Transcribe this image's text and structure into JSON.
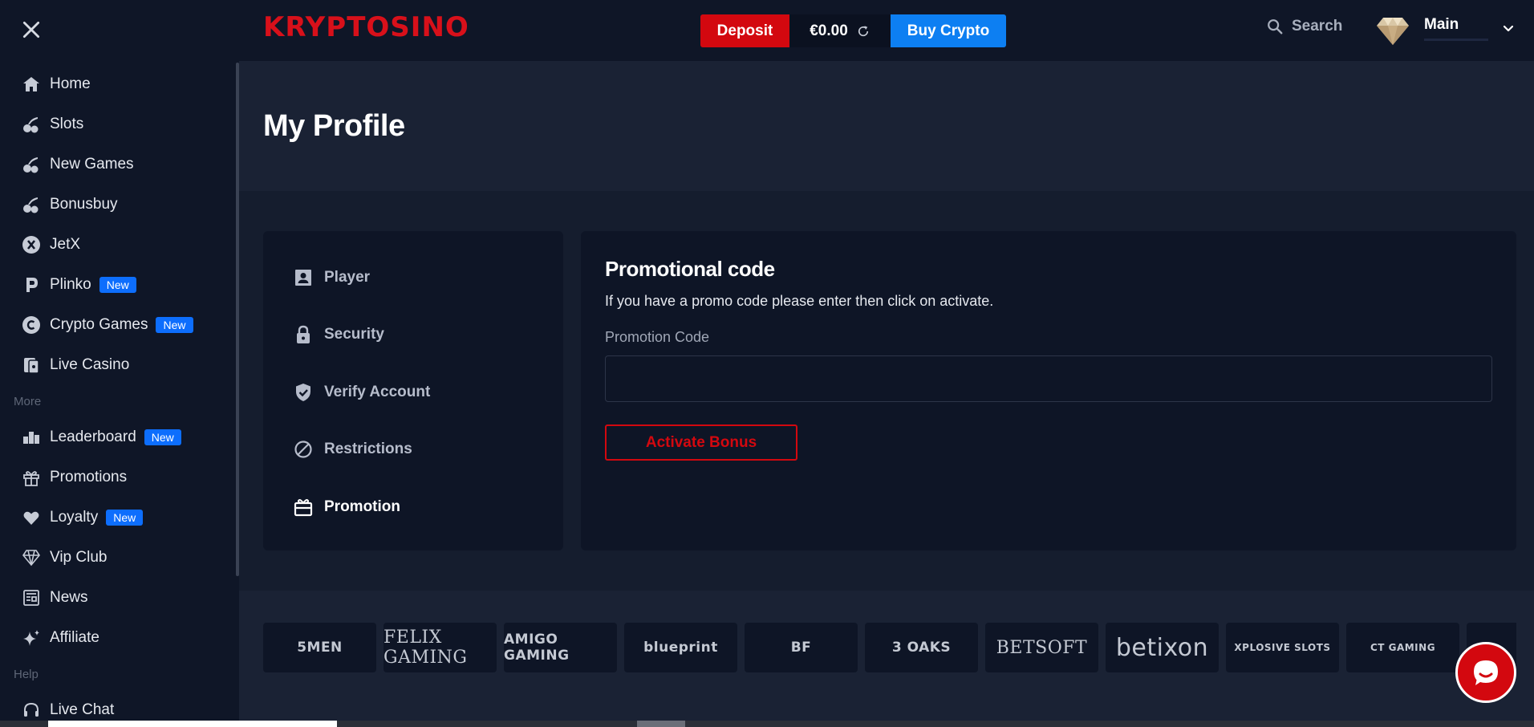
{
  "app": {
    "logo_text": "KRYPTOSINO"
  },
  "sidebar": {
    "items": [
      {
        "label": "Home",
        "icon": "home-icon",
        "badge": ""
      },
      {
        "label": "Slots",
        "icon": "cherries-icon",
        "badge": ""
      },
      {
        "label": "New Games",
        "icon": "cherries-icon",
        "badge": ""
      },
      {
        "label": "Bonusbuy",
        "icon": "cherries-icon",
        "badge": ""
      },
      {
        "label": "JetX",
        "icon": "jetx-icon",
        "badge": ""
      },
      {
        "label": "Plinko",
        "icon": "plinko-icon",
        "badge": "New"
      },
      {
        "label": "Crypto Games",
        "icon": "crypto-icon",
        "badge": "New"
      },
      {
        "label": "Live Casino",
        "icon": "cards-icon",
        "badge": ""
      }
    ],
    "more_label": "More",
    "more_items": [
      {
        "label": "Leaderboard",
        "icon": "bar-chart-icon",
        "badge": "New"
      },
      {
        "label": "Promotions",
        "icon": "gift-icon",
        "badge": ""
      },
      {
        "label": "Loyalty",
        "icon": "heart-icon",
        "badge": "New"
      },
      {
        "label": "Vip Club",
        "icon": "diamond-icon",
        "badge": ""
      },
      {
        "label": "News",
        "icon": "newspaper-icon",
        "badge": ""
      },
      {
        "label": "Affiliate",
        "icon": "sparkle-icon",
        "badge": ""
      }
    ],
    "help_label": "Help",
    "help_items": [
      {
        "label": "Live Chat",
        "icon": "headset-icon"
      }
    ]
  },
  "header": {
    "deposit_label": "Deposit",
    "balance": "€0.00",
    "buy_crypto_label": "Buy Crypto",
    "search_label": "Search",
    "account_name": "Main"
  },
  "page": {
    "title": "My Profile"
  },
  "profile_menu": [
    {
      "label": "Player",
      "icon": "user-card-icon",
      "active": false
    },
    {
      "label": "Security",
      "icon": "lock-icon",
      "active": false
    },
    {
      "label": "Verify Account",
      "icon": "shield-check-icon",
      "active": false
    },
    {
      "label": "Restrictions",
      "icon": "block-icon",
      "active": false
    },
    {
      "label": "Promotion",
      "icon": "gift-card-icon",
      "active": true
    }
  ],
  "promo": {
    "title": "Promotional code",
    "description": "If you have a promo code please enter then click on activate.",
    "field_label": "Promotion Code",
    "field_value": "",
    "button_label": "Activate Bonus"
  },
  "providers": [
    "5MEN",
    "FELIX GAMING",
    "AMIGO GAMING",
    "blueprint",
    "BF",
    "3 OAKS",
    "BETSOFT",
    "betixon",
    "XPLOSIVE SLOTS",
    "CT GAMING",
    ""
  ],
  "colors": {
    "accent_red": "#d3080f",
    "accent_blue": "#0d7ff2",
    "badge_blue": "#0d6efd",
    "sidebar_bg": "#0f1627"
  }
}
